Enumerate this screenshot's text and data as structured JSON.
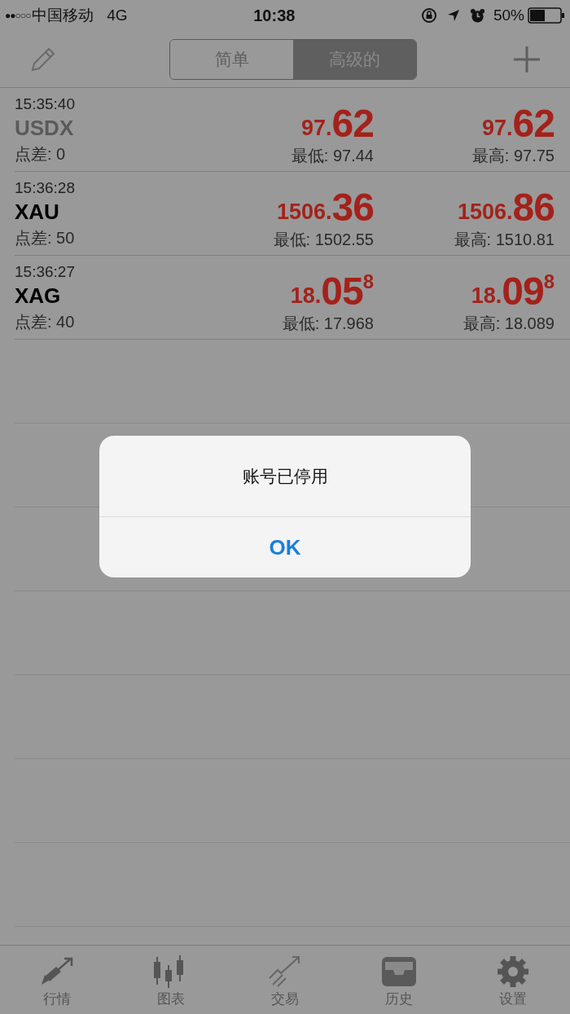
{
  "status_bar": {
    "signal": "●●○○○",
    "carrier": "中国移动",
    "network": "4G",
    "time": "10:38",
    "battery": "50%"
  },
  "header": {
    "segments": [
      {
        "label": "简单",
        "selected": false
      },
      {
        "label": "高级的",
        "selected": true
      }
    ]
  },
  "quotes": [
    {
      "time": "15:35:40",
      "symbol": "USDX",
      "muted": true,
      "spread": "点差: 0",
      "bid": {
        "small": "97.",
        "big": "62"
      },
      "low": "最低: 97.44",
      "ask": {
        "small": "97.",
        "big": "62"
      },
      "high": "最高: 97.75"
    },
    {
      "time": "15:36:28",
      "symbol": "XAU",
      "muted": false,
      "spread": "点差: 50",
      "bid": {
        "small": "1506.",
        "big": "36"
      },
      "low": "最低: 1502.55",
      "ask": {
        "small": "1506.",
        "big": "86"
      },
      "high": "最高: 1510.81"
    },
    {
      "time": "15:36:27",
      "symbol": "XAG",
      "muted": false,
      "spread": "点差: 40",
      "bid": {
        "small": "18.",
        "big": "05",
        "sup": "8"
      },
      "low": "最低: 17.968",
      "ask": {
        "small": "18.",
        "big": "09",
        "sup": "8"
      },
      "high": "最高: 18.089"
    }
  ],
  "alert": {
    "message": "账号已停用",
    "button": "OK"
  },
  "tab_bar": [
    {
      "kind": "quotes",
      "label": "行情"
    },
    {
      "kind": "chart",
      "label": "图表"
    },
    {
      "kind": "trade",
      "label": "交易"
    },
    {
      "kind": "history",
      "label": "历史"
    },
    {
      "kind": "settings",
      "label": "设置"
    }
  ]
}
